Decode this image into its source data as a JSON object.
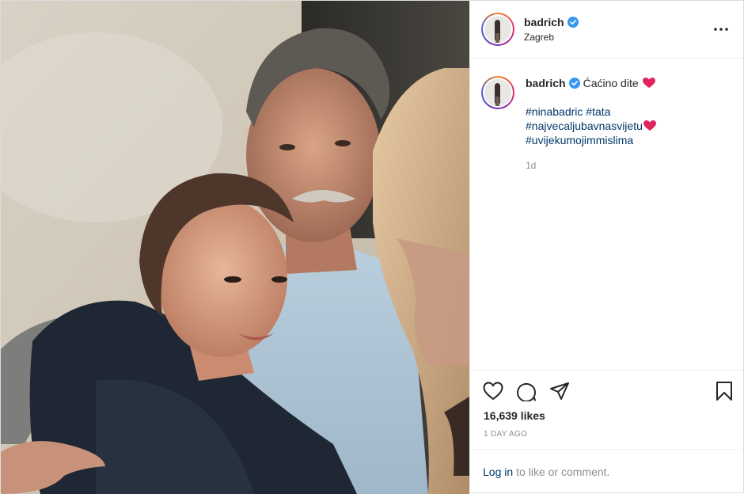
{
  "post": {
    "username": "badrich",
    "location": "Zagreb",
    "verified": true
  },
  "caption": {
    "username": "badrich",
    "text": "Ćaćino dite",
    "hashtags_line1": [
      "#ninabadric",
      "#tata"
    ],
    "hashtag_line2": "#najvecaljubavnasvijetu",
    "hashtag_line3": "#uvijekumojimmislima",
    "time_ago": "1d"
  },
  "engagement": {
    "likes": "16,639 likes",
    "date": "1 DAY AGO"
  },
  "comment_bar": {
    "login_link": "Log in",
    "prompt": "to like or comment."
  },
  "icons": {
    "more": "more-options-icon",
    "like": "heart-icon",
    "comment": "comment-icon",
    "share": "share-icon",
    "save": "bookmark-icon",
    "verified": "verified-badge-icon",
    "emoji": "red-heart-emoji"
  },
  "colors": {
    "verified_blue": "#3897f0",
    "link_blue": "#00376b",
    "heart_red": "#e0245e",
    "muted_gray": "#8e8e8e"
  }
}
